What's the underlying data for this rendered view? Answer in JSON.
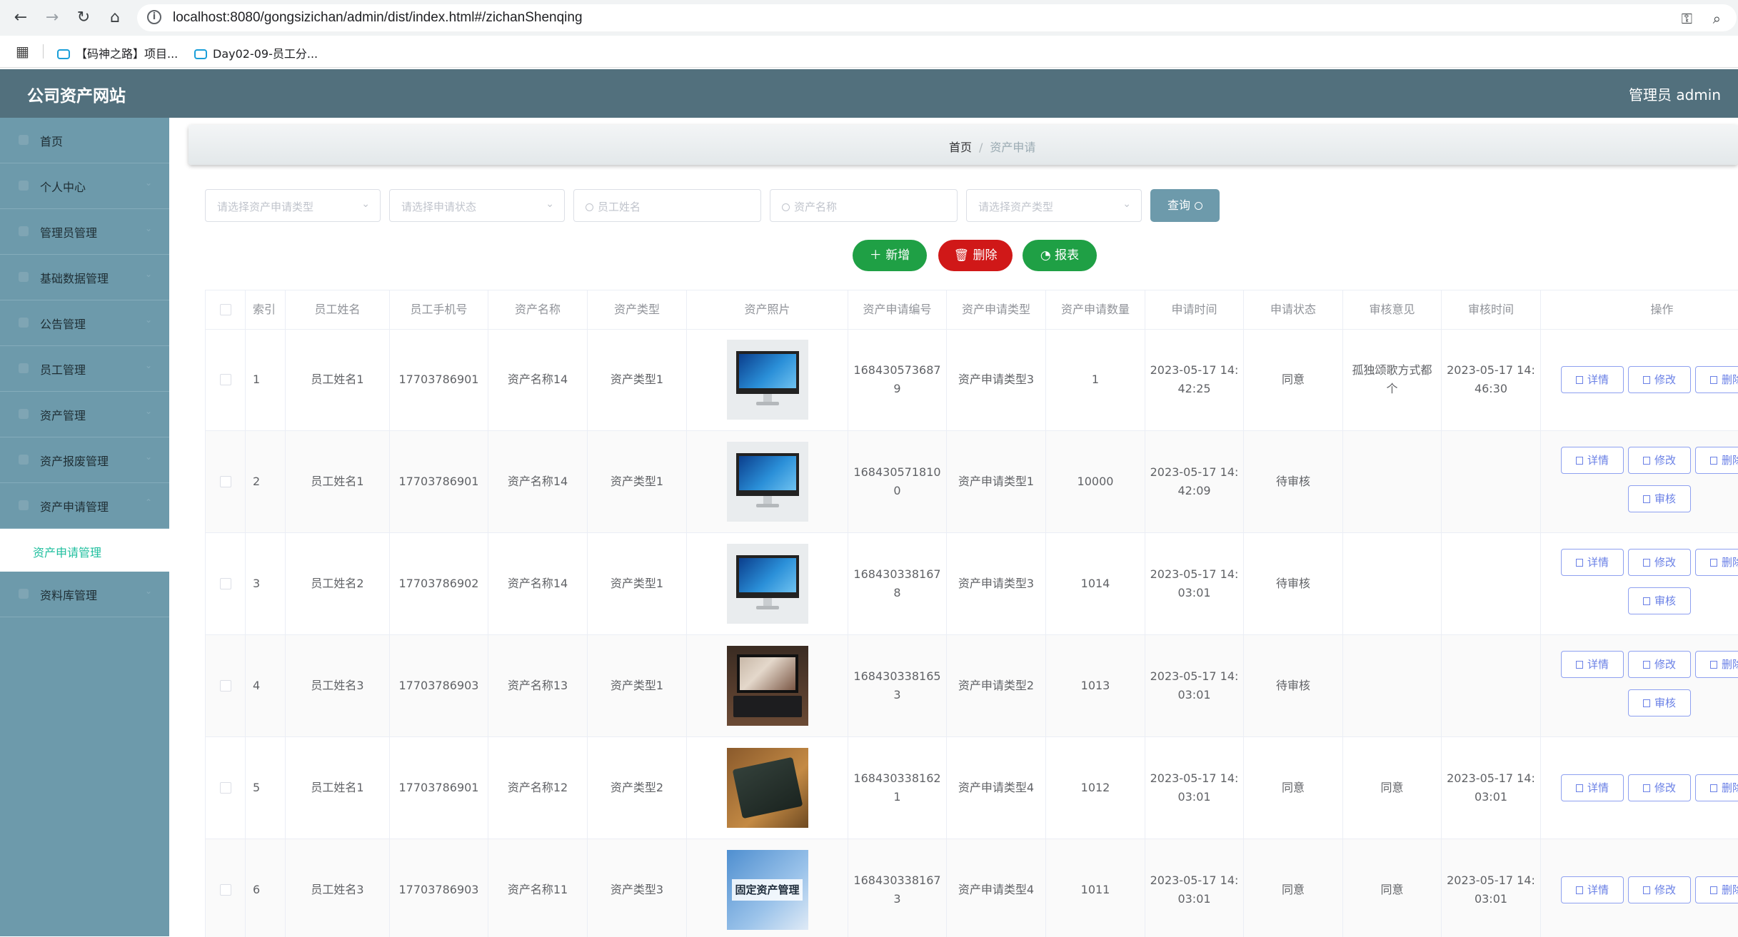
{
  "browser": {
    "url": "localhost:8080/gongsizichan/admin/dist/index.html#/zichanShenqing",
    "bookmarks": [
      {
        "label": "【码神之路】项目..."
      },
      {
        "label": "Day02-09-员工分..."
      }
    ]
  },
  "header": {
    "title": "公司资产网站",
    "user": "管理员 admin"
  },
  "sidebar": {
    "items": [
      {
        "label": "首页"
      },
      {
        "label": "个人中心"
      },
      {
        "label": "管理员管理"
      },
      {
        "label": "基础数据管理"
      },
      {
        "label": "公告管理"
      },
      {
        "label": "员工管理"
      },
      {
        "label": "资产管理"
      },
      {
        "label": "资产报废管理"
      },
      {
        "label": "资产申请管理"
      }
    ],
    "active_sub": "资产申请管理",
    "last_item": "资料库管理"
  },
  "breadcrumb": {
    "home": "首页",
    "separator": "/",
    "current": "资产申请"
  },
  "filters": {
    "apply_type": "请选择资产申请类型",
    "apply_status": "请选择申请状态",
    "employee_name": "员工姓名",
    "asset_name": "资产名称",
    "asset_type": "请选择资产类型",
    "query": "查询"
  },
  "actions": {
    "add": "新增",
    "delete": "删除",
    "report": "报表"
  },
  "colors": {
    "header_bg": "#52707d",
    "sidebar_bg": "#6d9aab",
    "active_sub": "#1fbf9e",
    "add": "#1fa045",
    "delete": "#d01818",
    "report": "#1fa045",
    "op_btn": "#6a80e6"
  },
  "table": {
    "columns": [
      "索引",
      "员工姓名",
      "员工手机号",
      "资产名称",
      "资产类型",
      "资产照片",
      "资产申请编号",
      "资产申请类型",
      "资产申请数量",
      "申请时间",
      "申请状态",
      "审核意见",
      "审核时间",
      "操作"
    ],
    "op_labels": {
      "detail": "详情",
      "edit": "修改",
      "delete": "删除",
      "review": "审核"
    },
    "rows": [
      {
        "index": "1",
        "name": "员工姓名1",
        "phone": "17703786901",
        "asset": "资产名称14",
        "type": "资产类型1",
        "photo": "monitor",
        "code1": "168430573687",
        "code2": "9",
        "apply_type": "资产申请类型3",
        "qty": "1",
        "time1": "2023-05-17 14:",
        "time2": "42:25",
        "status": "同意",
        "opinion1": "孤独颂歌方式都",
        "opinion2": "个",
        "rtime1": "2023-05-17 14:",
        "rtime2": "46:30",
        "review": false
      },
      {
        "index": "2",
        "name": "员工姓名1",
        "phone": "17703786901",
        "asset": "资产名称14",
        "type": "资产类型1",
        "photo": "monitor",
        "code1": "168430571810",
        "code2": "0",
        "apply_type": "资产申请类型1",
        "qty": "10000",
        "time1": "2023-05-17 14:",
        "time2": "42:09",
        "status": "待审核",
        "opinion1": "",
        "opinion2": "",
        "rtime1": "",
        "rtime2": "",
        "review": true
      },
      {
        "index": "3",
        "name": "员工姓名2",
        "phone": "17703786902",
        "asset": "资产名称14",
        "type": "资产类型1",
        "photo": "monitor",
        "code1": "168430338167",
        "code2": "8",
        "apply_type": "资产申请类型3",
        "qty": "1014",
        "time1": "2023-05-17 14:",
        "time2": "03:01",
        "status": "待审核",
        "opinion1": "",
        "opinion2": "",
        "rtime1": "",
        "rtime2": "",
        "review": true
      },
      {
        "index": "4",
        "name": "员工姓名3",
        "phone": "17703786903",
        "asset": "资产名称13",
        "type": "资产类型1",
        "photo": "laptop-dark",
        "code1": "168430338165",
        "code2": "3",
        "apply_type": "资产申请类型2",
        "qty": "1013",
        "time1": "2023-05-17 14:",
        "time2": "03:01",
        "status": "待审核",
        "opinion1": "",
        "opinion2": "",
        "rtime1": "",
        "rtime2": "",
        "review": true
      },
      {
        "index": "5",
        "name": "员工姓名1",
        "phone": "17703786901",
        "asset": "资产名称12",
        "type": "资产类型2",
        "photo": "laptop-green",
        "code1": "168430338162",
        "code2": "1",
        "apply_type": "资产申请类型4",
        "qty": "1012",
        "time1": "2023-05-17 14:",
        "time2": "03:01",
        "status": "同意",
        "opinion1": "同意",
        "opinion2": "",
        "rtime1": "2023-05-17 14:",
        "rtime2": "03:01",
        "review": false
      },
      {
        "index": "6",
        "name": "员工姓名3",
        "phone": "17703786903",
        "asset": "资产名称11",
        "type": "资产类型3",
        "photo": "asset-doc",
        "photo_text": "固定资产管理",
        "code1": "168430338167",
        "code2": "3",
        "apply_type": "资产申请类型4",
        "qty": "1011",
        "time1": "2023-05-17 14:",
        "time2": "03:01",
        "status": "同意",
        "opinion1": "同意",
        "opinion2": "",
        "rtime1": "2023-05-17 14:",
        "rtime2": "03:01",
        "review": false
      }
    ]
  }
}
